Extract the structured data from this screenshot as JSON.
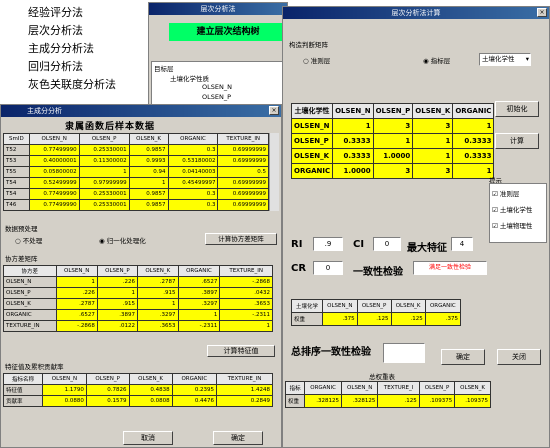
{
  "method_menu": {
    "items": [
      "经验评分法",
      "层次分析法",
      "主成分分析法",
      "回归分析法",
      "灰色关联度分析法"
    ]
  },
  "ahp_window": {
    "title": "层次分析法",
    "banner": "建立层次结构树",
    "tree": [
      "目标层",
      "土壤化学性质",
      "OLSEN_N",
      "OLSEN_P"
    ]
  },
  "pca_window": {
    "title": "主成分分析",
    "table_title": "隶属函数后样本数据",
    "data_cols": [
      "SmID",
      "OLSEN_N",
      "OLSEN_P",
      "OLSEN_K",
      "ORGANIC",
      "TEXTURE_IN"
    ],
    "data_rows": [
      [
        "T52",
        "0.77499990",
        "0.25330001",
        "0.9857",
        "0.3",
        "0.69999999"
      ],
      [
        "T53",
        "0.40000001",
        "0.11300002",
        "0.9993",
        "0.53180002",
        "0.69999999"
      ],
      [
        "T55",
        "0.05800002",
        "1",
        "0.94",
        "0.04140003",
        "0.5"
      ],
      [
        "T54",
        "0.52499999",
        "0.97999999",
        "1",
        "0.45499997",
        "0.69999999"
      ],
      [
        "T54",
        "0.77499990",
        "0.25330001",
        "0.9857",
        "0.3",
        "0.69999999"
      ],
      [
        "T46",
        "0.77499990",
        "0.25330001",
        "0.9857",
        "0.3",
        "0.69999999"
      ]
    ],
    "preprocess_label": "数据预处理",
    "radio_none": "不处理",
    "radio_norm": "归一化处理化",
    "calc_corr_btn": "计算协方差矩阵",
    "cov_label": "协方差矩阵",
    "cov_cols": [
      "协方差",
      "OLSEN_N",
      "OLSEN_P",
      "OLSEN_K",
      "ORGANIC",
      "TEXTURE_IN"
    ],
    "cov_rows": [
      [
        "OLSEN_N",
        "1",
        ".226",
        ".2787",
        ".6527",
        "-.2868"
      ],
      [
        "OLSEN_P",
        ".226",
        "1",
        ".915",
        ".3897",
        ".0432"
      ],
      [
        "OLSEN_K",
        ".2787",
        ".915",
        "1",
        ".3297",
        ".3653"
      ],
      [
        "ORGANIC",
        ".6527",
        ".3897",
        ".3297",
        "1",
        "-.2311"
      ],
      [
        "TEXTURE_IN",
        "-.2868",
        ".0122",
        ".3653",
        "-.2311",
        "1"
      ]
    ],
    "calc_eig_btn": "计算特征值",
    "eig_label": "特征值及累积贡献率",
    "eig_cols": [
      "指标名称",
      "OLSEN_N",
      "OLSEN_P",
      "OLSEN_K",
      "ORGANIC",
      "TEXTURE_IN"
    ],
    "eig_rows": [
      [
        "特征值",
        "1.1790",
        "0.7826",
        "0.4838",
        "0.2395",
        "1.4248"
      ],
      [
        "贡献率",
        "0.0880",
        "0.1579",
        "0.0808",
        "0.4476",
        "0.2849"
      ]
    ],
    "cancel_btn": "取消",
    "ok_btn": "确定"
  },
  "calc_window": {
    "title": "层次分析法计算",
    "judge_label": "构造判断矩阵",
    "radio_target": "准则层",
    "radio_index": "指标层",
    "select_value": "土壤化学性",
    "matrix_cols": [
      "土壤化学性",
      "OLSEN_N",
      "OLSEN_P",
      "OLSEN_K",
      "ORGANIC"
    ],
    "matrix_rows": [
      [
        "OLSEN_N",
        "1",
        "3",
        "3",
        "1"
      ],
      [
        "OLSEN_P",
        "0.3333",
        "1",
        "1",
        "0.3333"
      ],
      [
        "OLSEN_K",
        "0.3333",
        "1.0000",
        "1",
        "0.3333"
      ],
      [
        "ORGANIC",
        "1.0000",
        "3",
        "3",
        "1"
      ]
    ],
    "init_btn": "初始化",
    "calc_btn": "计算",
    "tips_label": "提示",
    "tips": [
      "准则层",
      "土壤化学性",
      "土壤物理性"
    ],
    "ri_label": "RI",
    "ri_value": ".9",
    "ci_label": "CI",
    "ci_value": "0",
    "max_eig_label": "最大特征",
    "max_eig_value": "4",
    "cr_label": "CR",
    "cr_value": "0",
    "consistency_label": "一致性检验",
    "consistency_result": "满足一致性检验",
    "weight_cols": [
      "土壤化学",
      "OLSEN_N",
      "OLSEN_P",
      "OLSEN_K",
      "ORGANIC"
    ],
    "weight_row": [
      "权重",
      ".375",
      ".125",
      ".125",
      ".375"
    ],
    "total_label": "总排序一致性检验",
    "confirm_btn": "确定",
    "close_btn": "关闭",
    "total_weight_title": "总权重表",
    "total_cols": [
      "指标",
      "ORGANIC",
      "OLSEN_N",
      "TEXTURE_I",
      "OLSEN_P",
      "OLSEN_K"
    ],
    "total_row": [
      "权重",
      ".328125",
      ".328125",
      ".125",
      ".109375",
      ".109375"
    ]
  }
}
